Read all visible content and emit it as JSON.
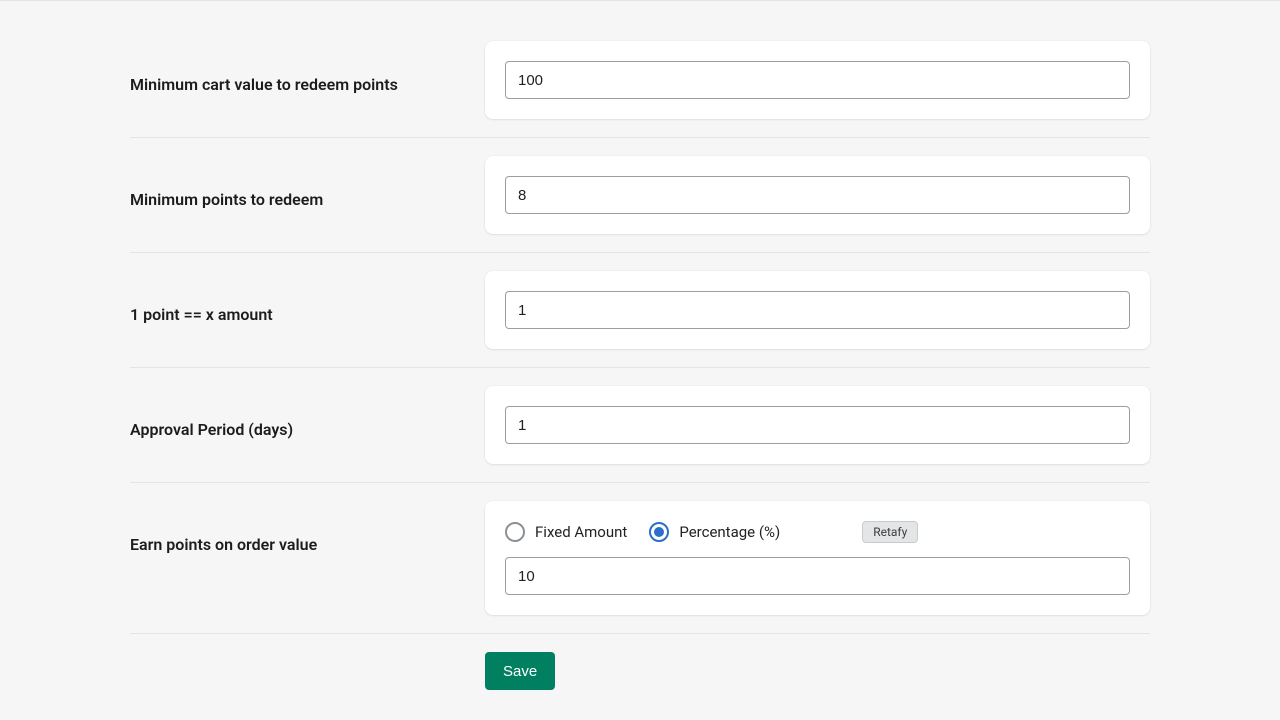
{
  "fields": {
    "min_cart_value": {
      "label": "Minimum cart value to redeem points",
      "value": "100"
    },
    "min_points_redeem": {
      "label": "Minimum points to redeem",
      "value": "8"
    },
    "point_amount": {
      "label": "1 point == x amount",
      "value": "1"
    },
    "approval_period": {
      "label": "Approval Period (days)",
      "value": "1"
    },
    "earn_points": {
      "label": "Earn points on order value",
      "options": {
        "fixed": "Fixed Amount",
        "percentage": "Percentage (%)"
      },
      "selected": "percentage",
      "value": "10",
      "tooltip": "Retafy"
    }
  },
  "actions": {
    "save": "Save"
  }
}
